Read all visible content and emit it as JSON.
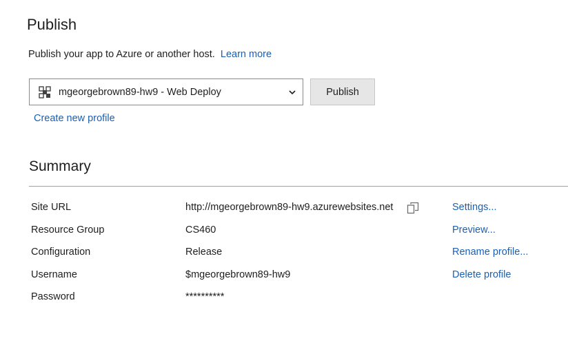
{
  "header": {
    "title": "Publish",
    "description": "Publish your app to Azure or another host.",
    "learn_more_label": "Learn more"
  },
  "profile": {
    "selected": "mgeorgebrown89-hw9 - Web Deploy",
    "icon": "web-deploy-icon",
    "publish_label": "Publish",
    "create_new_label": "Create new profile"
  },
  "summary": {
    "title": "Summary",
    "rows": [
      {
        "label": "Site URL",
        "value": "http://mgeorgebrown89-hw9.azurewebsites.net"
      },
      {
        "label": "Resource Group",
        "value": "CS460"
      },
      {
        "label": "Configuration",
        "value": "Release"
      },
      {
        "label": "Username",
        "value": "$mgeorgebrown89-hw9"
      },
      {
        "label": "Password",
        "value": "**********"
      }
    ],
    "actions": [
      {
        "label": "Settings..."
      },
      {
        "label": "Preview..."
      },
      {
        "label": "Rename profile..."
      },
      {
        "label": "Delete profile"
      }
    ]
  },
  "colors": {
    "link": "#1a5fb4",
    "text": "#1e1e1e",
    "button_bg": "#e6e6e6"
  }
}
